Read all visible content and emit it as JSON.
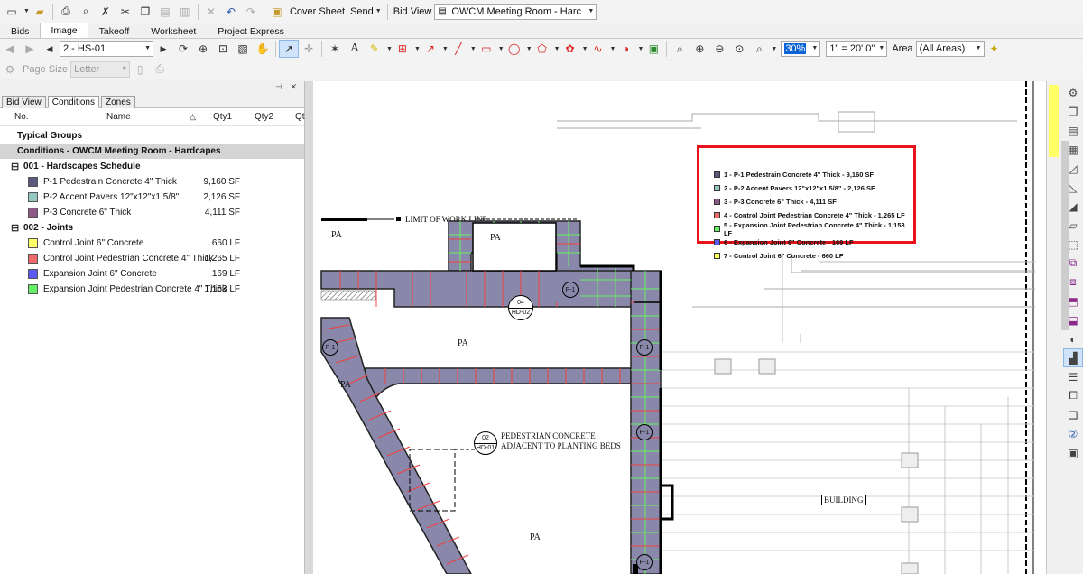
{
  "toolbar1": {
    "cover_sheet": "Cover Sheet",
    "send": "Send",
    "bid_view_label": "Bid View",
    "bid_view_value": "OWCM Meeting Room - Harc"
  },
  "tabs": [
    "Bids",
    "Image",
    "Takeoff",
    "Worksheet",
    "Project Express"
  ],
  "active_tab": "Image",
  "toolbar2": {
    "page_select": "2 - HS-01",
    "zoom": "30%",
    "scale": "1\" = 20' 0\"",
    "area_label": "Area",
    "area_value": "(All Areas)"
  },
  "toolbar3": {
    "page_size_label": "Page Size",
    "page_size_value": "Letter"
  },
  "panel_tabs": [
    "Bid View",
    "Conditions",
    "Zones"
  ],
  "active_panel_tab": "Conditions",
  "columns": {
    "no": "No.",
    "name": "Name",
    "qty1": "Qty1",
    "qty2": "Qty2",
    "qty3": "Qt"
  },
  "typical_groups": "Typical Groups",
  "conditions_header": "Conditions - OWCM Meeting Room - Hardcapes",
  "groups": [
    {
      "title": "001 - Hardscapes Schedule",
      "items": [
        {
          "name": "P-1 Pedestrain Concrete 4\" Thick",
          "qty": "9,160 SF",
          "color": "#5a587e"
        },
        {
          "name": "P-2 Accent Pavers 12\"x12\"x1 5/8\"",
          "qty": "2,126 SF",
          "color": "#96c7c0"
        },
        {
          "name": "P-3 Concrete 6\" Thick",
          "qty": "4,111 SF",
          "color": "#8b5a86"
        }
      ]
    },
    {
      "title": "002 - Joints",
      "items": [
        {
          "name": "Control Joint 6\" Concrete",
          "qty": "660 LF",
          "color": "#ffff66"
        },
        {
          "name": "Control Joint Pedestrian Concrete 4\" Thick",
          "qty": "1,265 LF",
          "color": "#f06a6a"
        },
        {
          "name": "Expansion Joint 6\" Concrete",
          "qty": "169 LF",
          "color": "#5a5af0"
        },
        {
          "name": "Expansion Joint Pedestrian Concrete 4\" Thick",
          "qty": "1,153 LF",
          "color": "#66f066"
        }
      ]
    }
  ],
  "legend": [
    {
      "text": "1 - P-1 Pedestrain Concrete 4\" Thick - 9,160 SF",
      "color": "#5a587e"
    },
    {
      "text": "2 - P-2 Accent Pavers 12\"x12\"x1 5/8\" - 2,126 SF",
      "color": "#96c7c0"
    },
    {
      "text": "3 - P-3 Concrete 6\" Thick - 4,111 SF",
      "color": "#8b5a86"
    },
    {
      "text": "4 - Control Joint Pedestrian Concrete 4\" Thick - 1,265 LF",
      "color": "#f06a6a"
    },
    {
      "text": "5 - Expansion Joint Pedestrian Concrete 4\" Thick - 1,153 LF",
      "color": "#66f066"
    },
    {
      "text": "6 - Expansion Joint 6\" Concrete - 169 LF",
      "color": "#5a5af0"
    },
    {
      "text": "7 - Control Joint 6\" Concrete - 660 LF",
      "color": "#ffff66"
    }
  ],
  "drawing": {
    "limit_of_work": "LIMIT OF WORK LINE",
    "pa": "PA",
    "p1": "P-1",
    "callout1_top": "04",
    "callout1_bottom": "HD-02",
    "callout2_top": "02",
    "callout2_bottom": "HD-01",
    "note_line1": "PEDESTRIAN CONCRETE",
    "note_line2": "ADJACENT TO PLANTING BEDS",
    "building": "BUILDING"
  },
  "colors": {
    "highlight_box": "#e8131b",
    "paving_fill": "#8a88aa",
    "selection": "#0a64d8"
  }
}
